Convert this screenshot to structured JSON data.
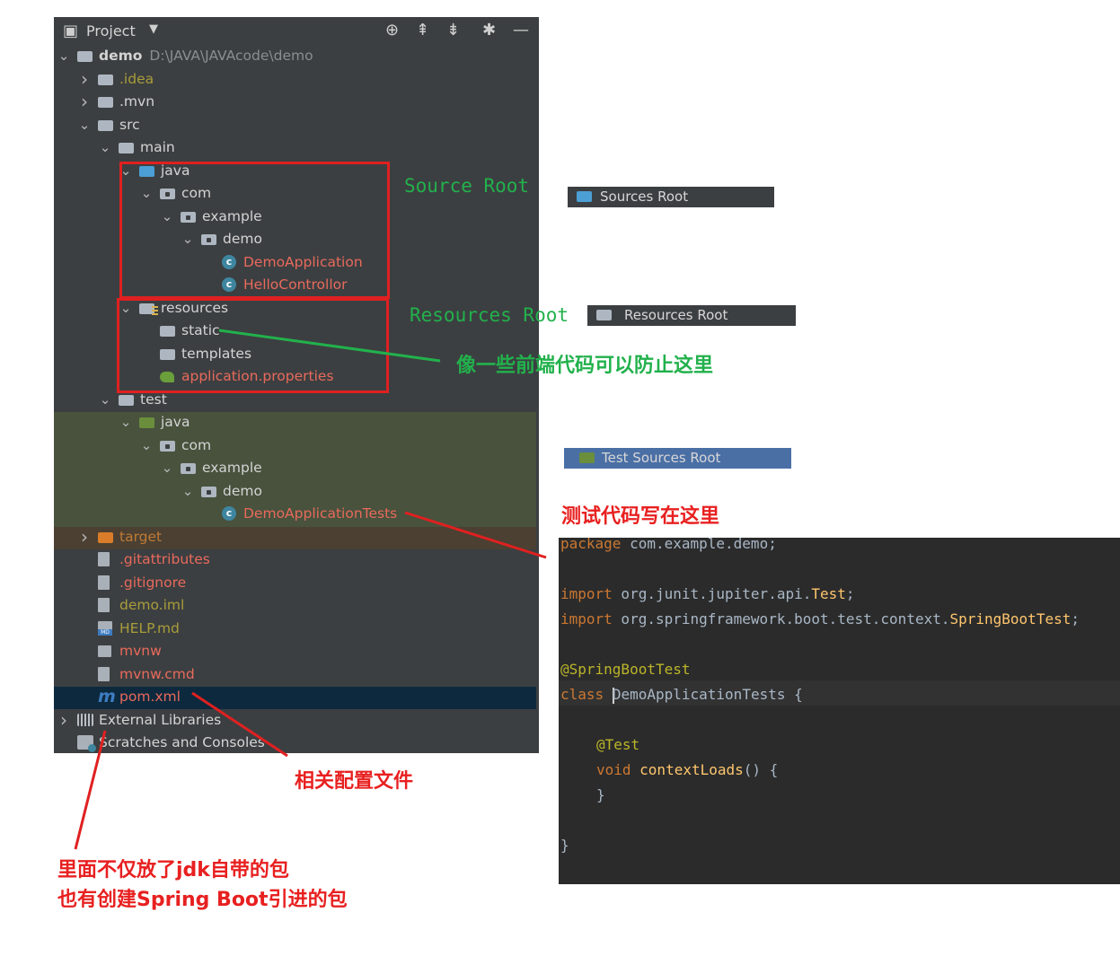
{
  "panel": {
    "title": "Project",
    "icons": [
      "project-icon",
      "dropdown-icon",
      "locate-icon",
      "expand-all-icon",
      "collapse-all-icon",
      "gear-icon",
      "minimize-icon"
    ]
  },
  "tree": [
    {
      "label": "demo",
      "path": "D:\\JAVA\\JAVAcode\\demo",
      "depth": 0,
      "expanded": true,
      "icon": "module-folder"
    },
    {
      "label": ".idea",
      "depth": 1,
      "expanded": false,
      "icon": "folder",
      "color": "#a89d3a"
    },
    {
      "label": ".mvn",
      "depth": 1,
      "expanded": false,
      "icon": "folder"
    },
    {
      "label": "src",
      "depth": 1,
      "expanded": true,
      "icon": "folder"
    },
    {
      "label": "main",
      "depth": 2,
      "expanded": true,
      "icon": "folder"
    },
    {
      "label": "java",
      "depth": 3,
      "expanded": true,
      "icon": "sources-root-folder"
    },
    {
      "label": "com",
      "depth": 4,
      "expanded": true,
      "icon": "package"
    },
    {
      "label": "example",
      "depth": 5,
      "expanded": true,
      "icon": "package"
    },
    {
      "label": "demo",
      "depth": 6,
      "expanded": true,
      "icon": "package"
    },
    {
      "label": "DemoApplication",
      "depth": 7,
      "icon": "spring-class",
      "color": "#e86a5c"
    },
    {
      "label": "HelloControllor",
      "depth": 7,
      "icon": "class",
      "color": "#e86a5c"
    },
    {
      "label": "resources",
      "depth": 3,
      "expanded": true,
      "icon": "resources-root-folder"
    },
    {
      "label": "static",
      "depth": 4,
      "icon": "folder"
    },
    {
      "label": "templates",
      "depth": 4,
      "icon": "folder"
    },
    {
      "label": "application.properties",
      "depth": 4,
      "icon": "spring-properties",
      "color": "#e86a5c"
    },
    {
      "label": "test",
      "depth": 2,
      "expanded": true,
      "icon": "folder"
    },
    {
      "label": "java",
      "depth": 3,
      "expanded": true,
      "icon": "test-sources-root-folder"
    },
    {
      "label": "com",
      "depth": 4,
      "expanded": true,
      "icon": "package"
    },
    {
      "label": "example",
      "depth": 5,
      "expanded": true,
      "icon": "package"
    },
    {
      "label": "demo",
      "depth": 6,
      "expanded": true,
      "icon": "package"
    },
    {
      "label": "DemoApplicationTests",
      "depth": 7,
      "icon": "spring-class",
      "color": "#e86a5c"
    },
    {
      "label": "target",
      "depth": 1,
      "expanded": false,
      "icon": "excluded-folder",
      "color": "#c07a35"
    },
    {
      "label": ".gitattributes",
      "depth": 1,
      "icon": "file",
      "color": "#e86a5c"
    },
    {
      "label": ".gitignore",
      "depth": 1,
      "icon": "ignore-file",
      "color": "#e86a5c"
    },
    {
      "label": "demo.iml",
      "depth": 1,
      "icon": "iml-file",
      "color": "#a89d3a"
    },
    {
      "label": "HELP.md",
      "depth": 1,
      "icon": "markdown-file",
      "color": "#a89d3a"
    },
    {
      "label": "mvnw",
      "depth": 1,
      "icon": "terminal-file",
      "color": "#e86a5c"
    },
    {
      "label": "mvnw.cmd",
      "depth": 1,
      "icon": "file",
      "color": "#e86a5c"
    },
    {
      "label": "pom.xml",
      "depth": 1,
      "icon": "maven-file",
      "color": "#e86a5c",
      "selected": true
    },
    {
      "label": "External Libraries",
      "depth": 0,
      "expanded": false,
      "icon": "libraries"
    },
    {
      "label": "Scratches and Consoles",
      "depth": 0,
      "icon": "scratches"
    }
  ],
  "annotations": {
    "source_root": "Source Root",
    "resources_root": "Resources Root",
    "static_note": "像一些前端代码可以防止这里",
    "test_note": "测试代码写在这里",
    "pom_note": "相关配置文件",
    "libs_note_line1": "里面不仅放了jdk自带的包",
    "libs_note_line2": "也有创建Spring Boot引进的包"
  },
  "legends": {
    "sources_root": "Sources Root",
    "resources_root": "Resources Root",
    "test_sources_root": "Test Sources Root"
  },
  "code": {
    "package_kw": "package",
    "package_name": " com.example.demo;",
    "import_kw": "import",
    "import1_path": " org.junit.jupiter.api.",
    "import1_cls": "Test",
    "import2_path": " org.springframework.boot.test.context.",
    "import2_cls": "SpringBootTest",
    "semicolon": ";",
    "annotation1": "@SpringBootTest",
    "class_kw": "class",
    "class_name_first": "D",
    "class_name_rest": "emoApplicationTests",
    "open_brace": " {",
    "annotation2": "@Test",
    "void_kw": "void",
    "method_name": " contextLoads",
    "method_tail": "() {",
    "close_inner": "}",
    "close_outer": "}"
  },
  "colors": {
    "panel_bg": "#3c3f41",
    "editor_bg": "#2b2b2b",
    "annotation_red": "#e02020",
    "annotation_green": "#22b14c",
    "sources_root_blue": "#4b9fd5",
    "test_root_green": "#6a8e3c",
    "test_sources_legend_bg": "#4a6fa5"
  }
}
